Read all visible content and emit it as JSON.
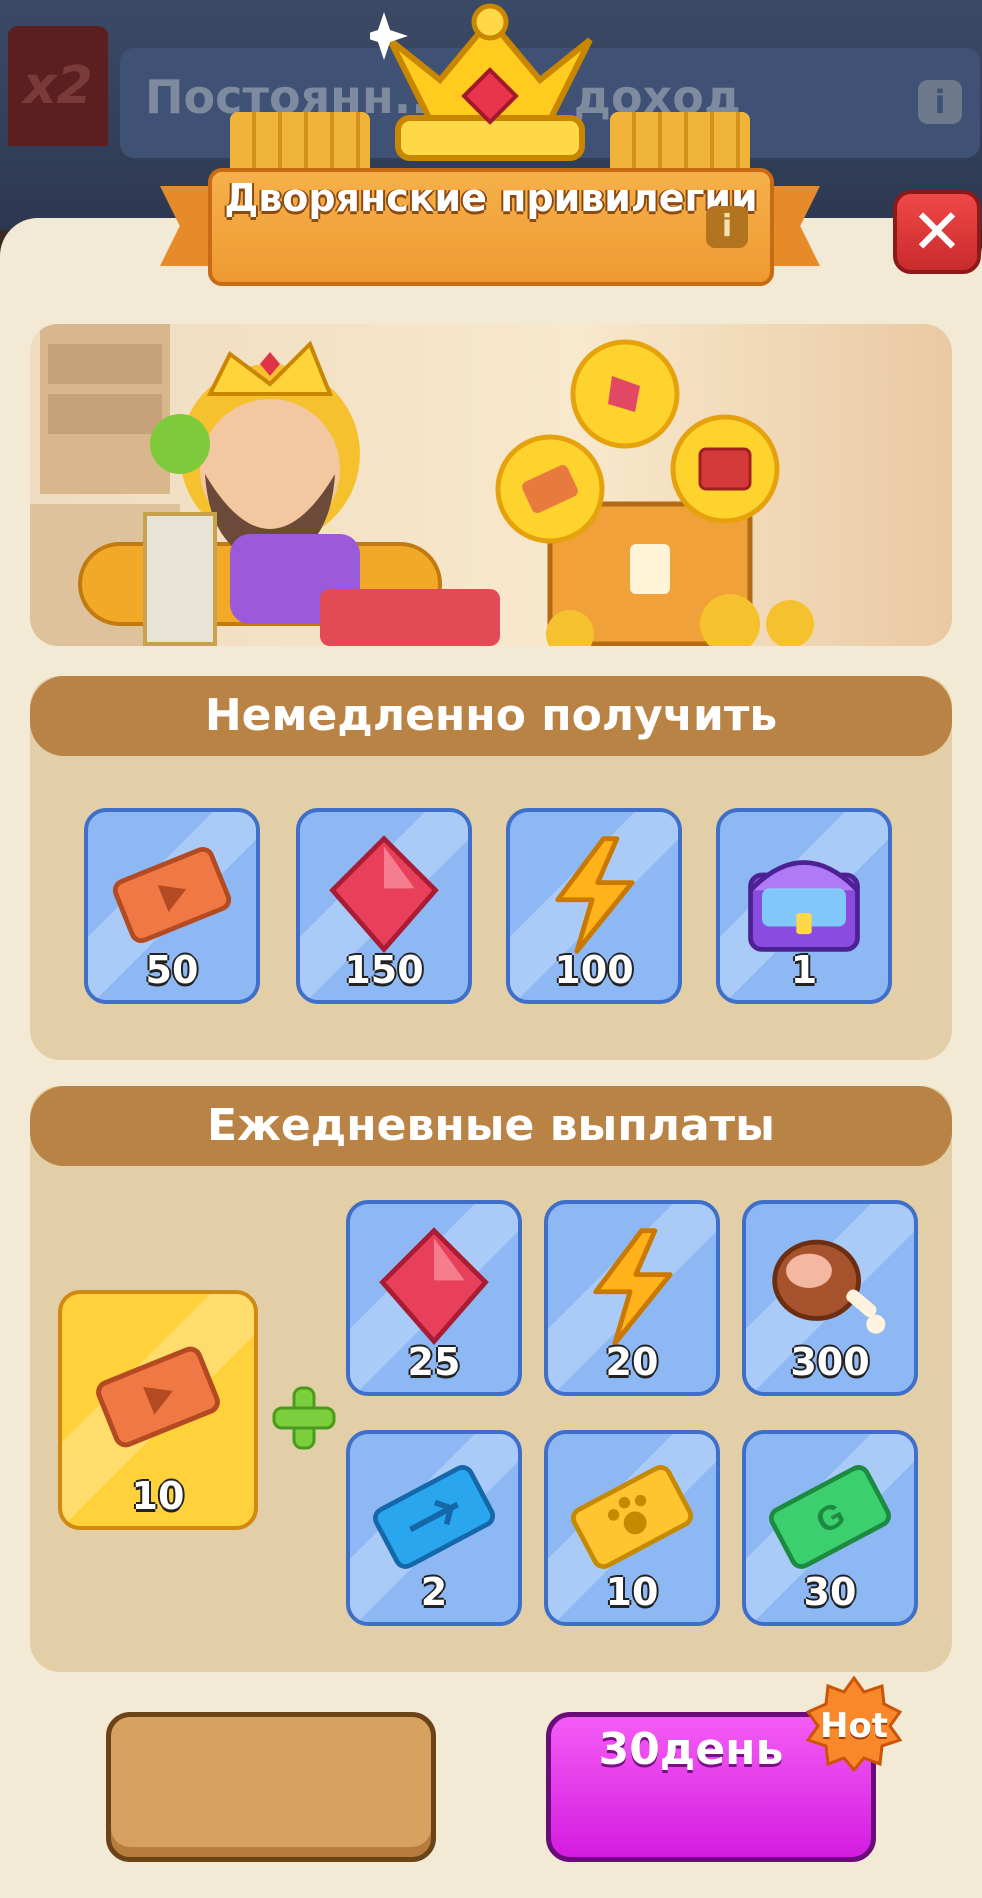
{
  "background": {
    "multiplier": "x2",
    "title": "Постоянн... ной доход"
  },
  "header": {
    "title": "Дворянские привилегии",
    "info_icon": "info-icon",
    "close_icon": "close-icon"
  },
  "instant": {
    "title": "Немедленно получить",
    "items": [
      {
        "icon": "video-ticket-icon",
        "qty": "50"
      },
      {
        "icon": "ruby-gem-icon",
        "qty": "150"
      },
      {
        "icon": "lightning-energy-icon",
        "qty": "100"
      },
      {
        "icon": "rainbow-chest-icon",
        "qty": "1"
      }
    ]
  },
  "daily": {
    "title": "Ежедневные выплаты",
    "main_item": {
      "icon": "video-ticket-icon",
      "qty": "10"
    },
    "items": [
      {
        "icon": "ruby-gem-icon",
        "qty": "25"
      },
      {
        "icon": "lightning-energy-icon",
        "qty": "20"
      },
      {
        "icon": "meat-drumstick-icon",
        "qty": "300"
      },
      {
        "icon": "airplane-ticket-icon",
        "qty": "2"
      },
      {
        "icon": "paw-ticket-icon",
        "qty": "10"
      },
      {
        "icon": "g-ticket-icon",
        "qty": "30"
      }
    ]
  },
  "buttons": {
    "left_label": "",
    "right_label": "30день",
    "badge": "Hot"
  },
  "colors": {
    "panel": "#f3ead6",
    "section": "#e2cfa8",
    "section_header": "#b98345",
    "item_blue": "#8db8f4",
    "item_gold": "#ffd23b",
    "purchase_button": "#e23ae8",
    "close_button": "#e23a3a"
  }
}
